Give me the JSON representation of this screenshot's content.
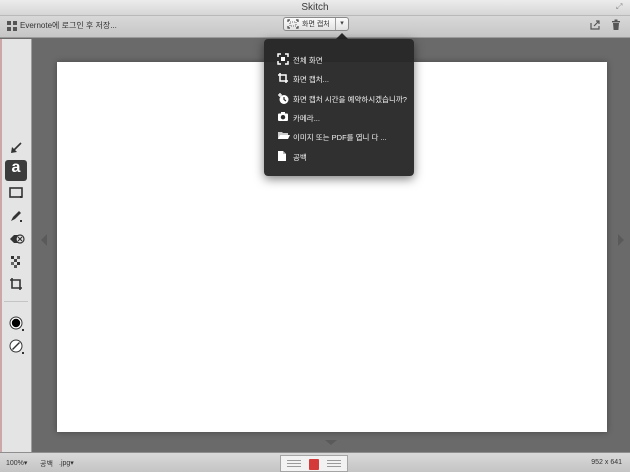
{
  "window": {
    "title": "Skitch"
  },
  "toolbar": {
    "evernote_label": "Evernote에 로그인 후 저장...",
    "capture_label": "화면 캡처",
    "capture_arrow": "▾"
  },
  "menu": {
    "items": [
      {
        "icon": "fullscreen-icon",
        "label": "전체 화면"
      },
      {
        "icon": "crop-capture-icon",
        "label": "화면 캡처..."
      },
      {
        "icon": "timer-icon",
        "label": "화면 캡처 시간을 예약하시겠습니까?"
      },
      {
        "icon": "camera-icon",
        "label": "카메라..."
      },
      {
        "icon": "folder-icon",
        "label": "이미지 또는 PDF를 엽니 다 ..."
      },
      {
        "icon": "blank-document-icon",
        "label": "공백"
      }
    ]
  },
  "tools": {
    "text_tool_glyph": "a",
    "items": [
      "arrow-icon",
      "text-icon",
      "rectangle-icon",
      "pen-icon",
      "stamp-icon",
      "pixelate-icon",
      "crop-icon",
      "color-icon",
      "stroke-width-icon"
    ]
  },
  "statusbar": {
    "zoom": "100%▾",
    "blank": "공백",
    "format": ".jpg▾",
    "dimensions": "952 x 641"
  },
  "colors": {
    "canvas_bg": "#6a6a6a",
    "menu_bg": "#2a2a2a",
    "panel_bg": "#e4e4e4"
  }
}
